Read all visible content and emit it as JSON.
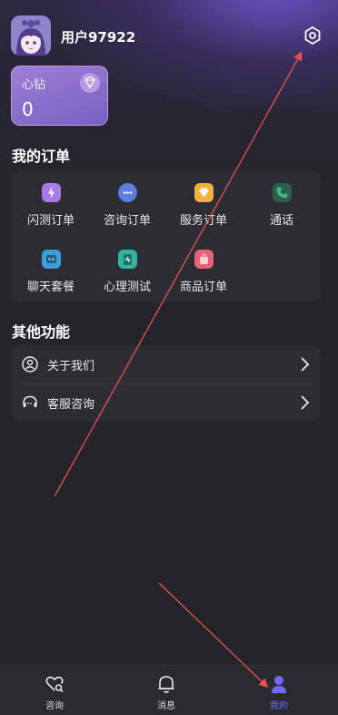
{
  "profile": {
    "username": "用户97922"
  },
  "diamond": {
    "title": "心钻",
    "value": "0"
  },
  "orders": {
    "title": "我的订单",
    "items": [
      {
        "label": "闪测订单",
        "icon": "lightning-icon",
        "color": "#a879e8"
      },
      {
        "label": "咨询订单",
        "icon": "chat-bubble-icon",
        "color": "#5b7fe0"
      },
      {
        "label": "服务订单",
        "icon": "diamond-icon",
        "color": "#f0b23a"
      },
      {
        "label": "通话",
        "icon": "phone-icon",
        "color": "#3fb88a"
      },
      {
        "label": "聊天套餐",
        "icon": "chat-package-icon",
        "color": "#3d9fd6"
      },
      {
        "label": "心理测试",
        "icon": "clipboard-icon",
        "color": "#2fb5a0"
      },
      {
        "label": "商品订单",
        "icon": "shopping-bag-icon",
        "color": "#e8607a"
      }
    ]
  },
  "others": {
    "title": "其他功能",
    "items": [
      {
        "label": "关于我们",
        "icon": "user-circle-icon"
      },
      {
        "label": "客服咨询",
        "icon": "headset-chat-icon"
      }
    ]
  },
  "tabbar": {
    "tabs": [
      {
        "label": "咨询",
        "icon": "heart-search-icon"
      },
      {
        "label": "消息",
        "icon": "bell-icon"
      },
      {
        "label": "我的",
        "icon": "user-icon",
        "active": true
      }
    ]
  },
  "colors": {
    "accent": "#6f6aff",
    "background": "#25242b",
    "card": "#2d2c33",
    "annotation_arrow": "#e8524f"
  }
}
